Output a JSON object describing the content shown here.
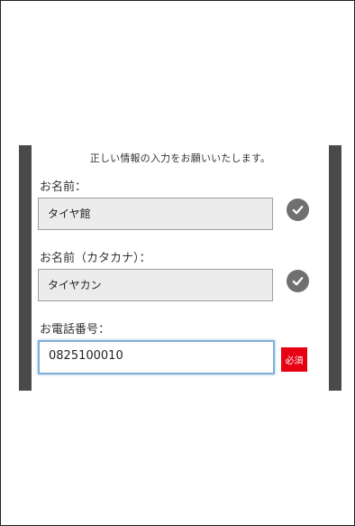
{
  "form": {
    "intro_text": "正しい情報の入力をお願いいたします。",
    "name": {
      "label": "お名前：",
      "value": "タイヤ館",
      "status_icon": "check-circle-icon"
    },
    "name_kana": {
      "label": "お名前（カタカナ）：",
      "value": "タイヤカン",
      "status_icon": "check-circle-icon"
    },
    "phone": {
      "label": "お電話番号：",
      "value": "0825100010",
      "required_badge": "必須"
    }
  },
  "colors": {
    "side_band": "#4a4a4a",
    "required_red": "#e60012",
    "check_gray": "#707070",
    "focus_blue": "#7fb0d8"
  }
}
